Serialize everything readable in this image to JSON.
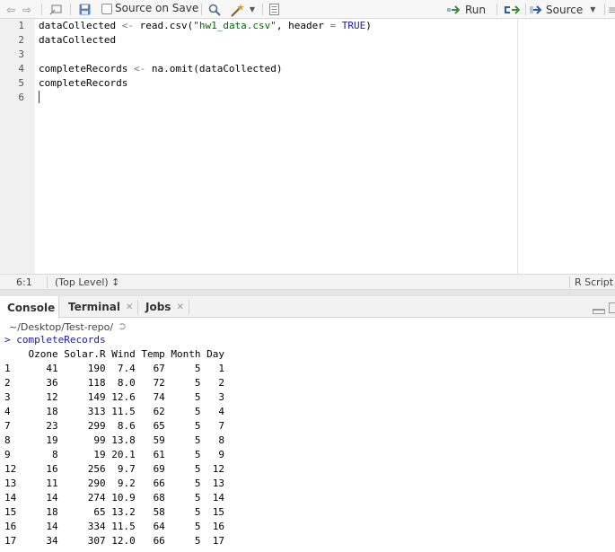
{
  "toolbar": {
    "source_on_save_label": "Source on Save",
    "run_label": "Run",
    "source_label": "Source"
  },
  "editor": {
    "line_numbers": [
      "1",
      "2",
      "3",
      "4",
      "5",
      "6"
    ],
    "lines": [
      [
        {
          "text": "dataCollected",
          "kind": "id"
        },
        {
          "text": " <- ",
          "kind": "op"
        },
        {
          "text": "read.csv(",
          "kind": "id"
        },
        {
          "text": "\"hw1_data.csv\"",
          "kind": "str"
        },
        {
          "text": ", header ",
          "kind": "id"
        },
        {
          "text": "=",
          "kind": "op"
        },
        {
          "text": " ",
          "kind": "id"
        },
        {
          "text": "TRUE",
          "kind": "kw"
        },
        {
          "text": ")",
          "kind": "id"
        }
      ],
      [
        {
          "text": "dataCollected",
          "kind": "id"
        }
      ],
      [],
      [
        {
          "text": "completeRecords",
          "kind": "id"
        },
        {
          "text": " <- ",
          "kind": "op"
        },
        {
          "text": "na.omit(dataCollected)",
          "kind": "id"
        }
      ],
      [
        {
          "text": "completeRecords",
          "kind": "id"
        }
      ],
      []
    ]
  },
  "statusbar": {
    "cursor_position": "6:1",
    "scope": "(Top Level) ↕",
    "file_type": "R Script"
  },
  "console_pane": {
    "tabs": [
      {
        "label": "Console",
        "closable": false
      },
      {
        "label": "Terminal",
        "closable": true
      },
      {
        "label": "Jobs",
        "closable": true
      }
    ],
    "working_dir": "~/Desktop/Test-repo/",
    "prompt": ">",
    "last_command": "completeRecords",
    "table_header": "    Ozone Solar.R Wind Temp Month Day",
    "table_rows": [
      "1      41     190  7.4   67     5   1",
      "2      36     118  8.0   72     5   2",
      "3      12     149 12.6   74     5   3",
      "4      18     313 11.5   62     5   4",
      "7      23     299  8.6   65     5   7",
      "8      19      99 13.8   59     5   8",
      "9       8      19 20.1   61     5   9",
      "12     16     256  9.7   69     5  12",
      "13     11     290  9.2   66     5  13",
      "14     14     274 10.9   68     5  14",
      "15     18      65 13.2   58     5  15",
      "16     14     334 11.5   64     5  16",
      "17     34     307 12.0   66     5  17"
    ]
  }
}
